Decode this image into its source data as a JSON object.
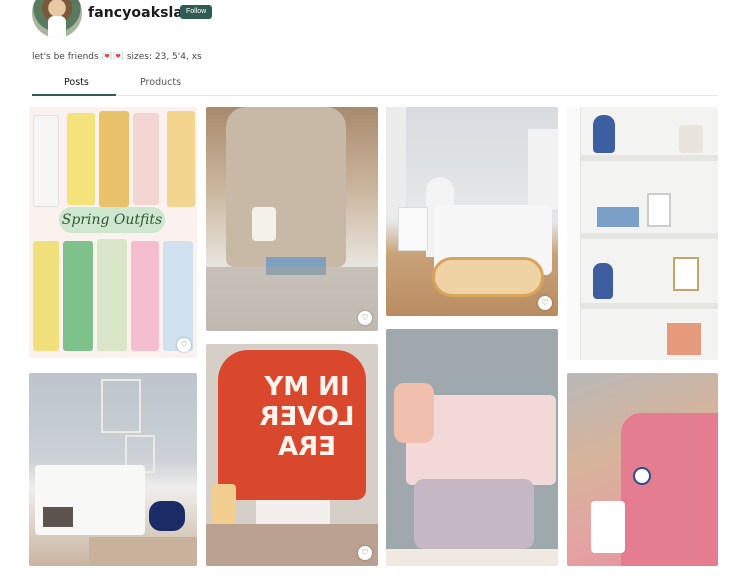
{
  "profile": {
    "username": "fancyoakslane",
    "follow_label": "Follow",
    "bio": "let's be friends 💌💌 sizes: 23, 5'4, xs"
  },
  "tabs": [
    {
      "label": "Posts",
      "active": true
    },
    {
      "label": "Products",
      "active": false
    }
  ],
  "accent_color": "#2f5d56",
  "posts": [
    {
      "caption": "Spring Outfits",
      "liked": false
    },
    {
      "caption": "",
      "liked": false
    },
    {
      "caption": "",
      "liked": false
    },
    {
      "caption": "",
      "liked": false
    },
    {
      "caption": "",
      "liked": false
    },
    {
      "caption": "IN MY LOVER ERA",
      "liked": false
    },
    {
      "caption": "",
      "liked": false
    },
    {
      "caption": "",
      "liked": false
    }
  ],
  "icons": {
    "heart": "heart-icon"
  }
}
